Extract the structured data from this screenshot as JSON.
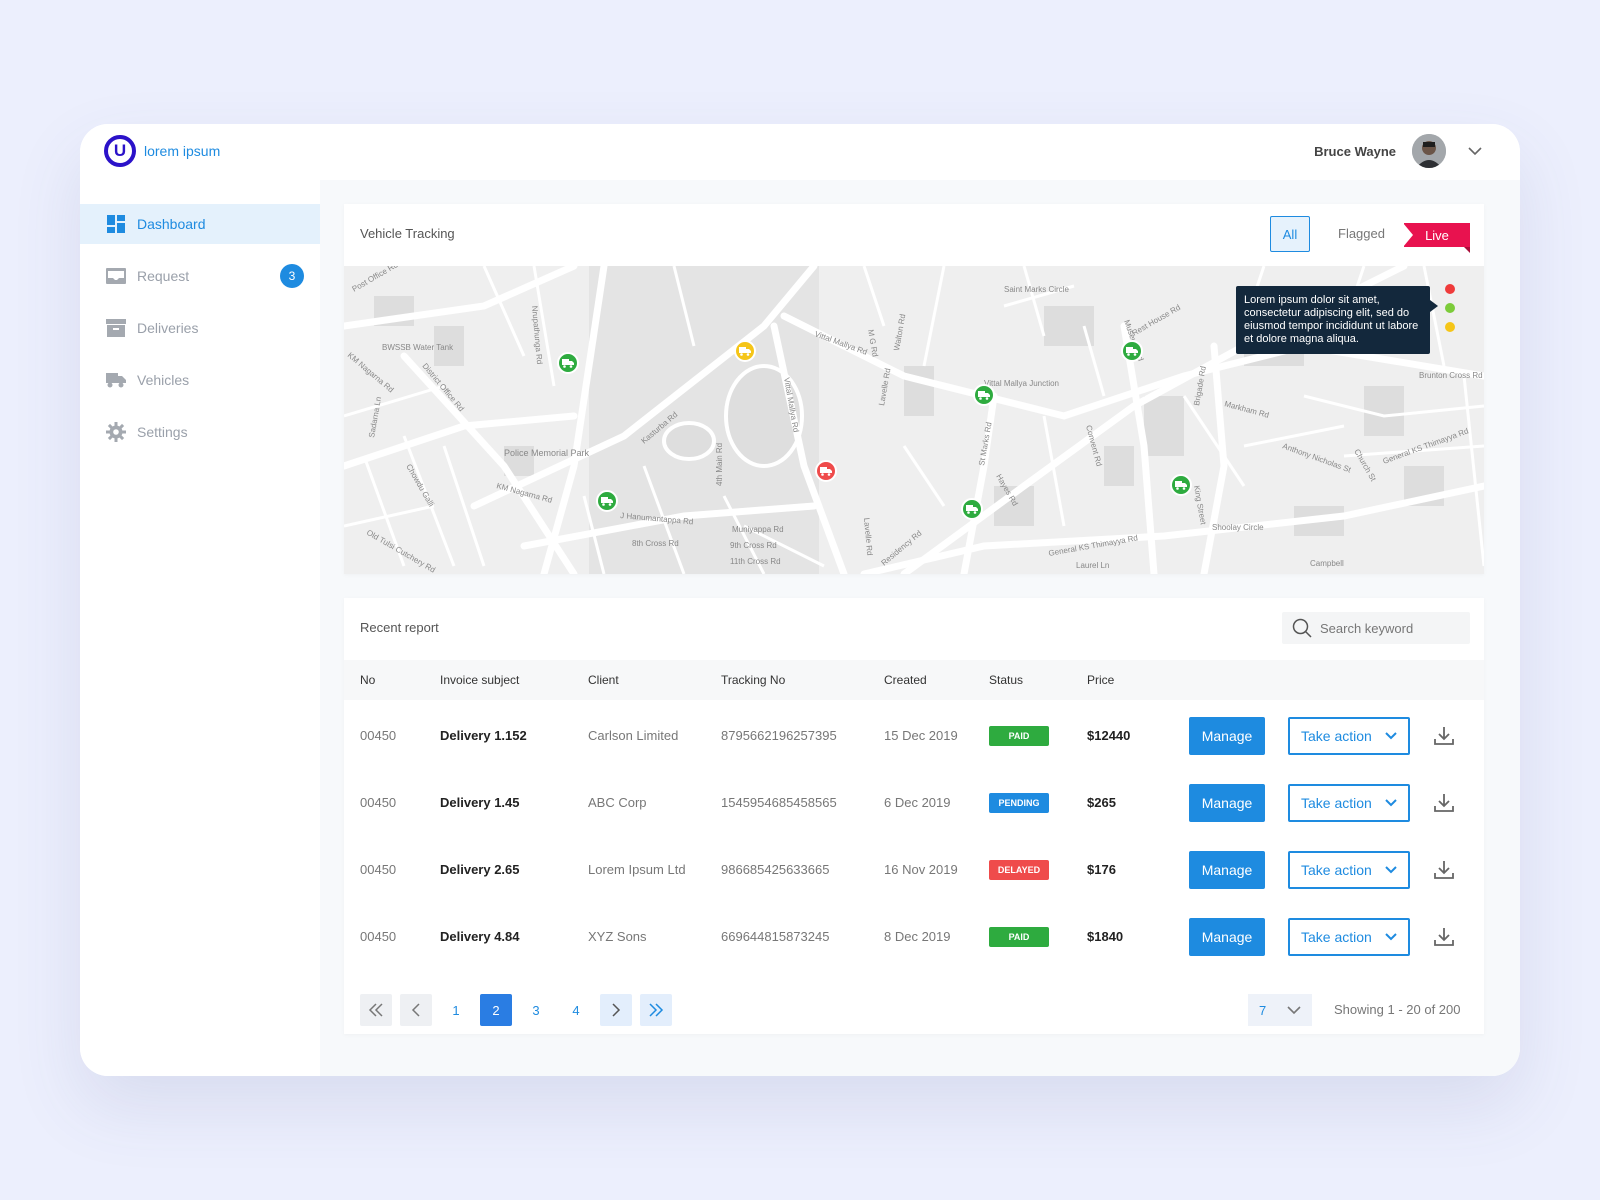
{
  "app": {
    "logo_letter": "U",
    "name": "lorem ipsum"
  },
  "user": {
    "name": "Bruce Wayne",
    "menu_icon": "chevron-down-icon"
  },
  "sidebar": {
    "items": [
      {
        "label": "Dashboard",
        "icon": "dashboard-icon",
        "active": true
      },
      {
        "label": "Request",
        "icon": "inbox-icon",
        "badge": "3"
      },
      {
        "label": "Deliveries",
        "icon": "archive-icon"
      },
      {
        "label": "Vehicles",
        "icon": "truck-icon"
      },
      {
        "label": "Settings",
        "icon": "gear-icon"
      }
    ]
  },
  "tracking": {
    "title": "Vehicle Tracking",
    "tabs": {
      "all": "All",
      "flagged": "Flagged"
    },
    "live_label": "Live",
    "tooltip": "Lorem ipsum dolor sit amet, consectetur adipiscing elit, sed do eiusmod tempor incididunt ut labore et dolore magna aliqua.",
    "status_colors": {
      "green": "#2eab3f",
      "yellow": "#f5c518",
      "red": "#ef4b4b"
    },
    "map_labels": [
      "Post Office Rd",
      "BWSSB Water Tank",
      "KM Nagarna Rd",
      "District Office Rd",
      "Nrupathunga Rd",
      "Police Memorial Park",
      "Kasturba Rd",
      "Vittal Mallya Rd",
      "Vittal Mallya Rd",
      "Vittal Mallya Junction",
      "St Marks Rd",
      "Museum Rd",
      "Saint Marks Circle",
      "Rest House Rd",
      "Residency Rd",
      "Brigade Rd",
      "Markham Rd",
      "Anthony Nicholas St",
      "Brunton Cross Rd",
      "General KS Thimayya Rd",
      "General KS Thimayya Rd",
      "Shoolay Circle",
      "King Street",
      "Church St",
      "Lavelle Rd",
      "Lavelle Rd",
      "M G Rd",
      "Walton Rd",
      "Hayes Rd",
      "Convent Rd",
      "Muniyappa Rd",
      "9th Cross Rd",
      "11th Cross Rd",
      "KM Nagarna Rd",
      "Old Tulsi Cutchery Rd",
      "Chowdu Galli",
      "Sadarna Ln",
      "Campbell",
      "Laurel Ln",
      "J Hanumantappa Rd",
      "4th Main Rd",
      "8th Cross Rd"
    ]
  },
  "report": {
    "title": "Recent report",
    "search_placeholder": "Search keyword",
    "columns": [
      "No",
      "Invoice subject",
      "Client",
      "Tracking No",
      "Created",
      "Status",
      "Price"
    ],
    "rows": [
      {
        "no": "00450",
        "subject": "Delivery 1.152",
        "client": "Carlson Limited",
        "tracking": "8795662196257395",
        "created": "15 Dec 2019",
        "status": "PAID",
        "status_color": "#2eab3f",
        "price": "$12440"
      },
      {
        "no": "00450",
        "subject": "Delivery 1.45",
        "client": "ABC Corp",
        "tracking": "1545954685458565",
        "created": "6 Dec 2019",
        "status": "PENDING",
        "status_color": "#1e8be0",
        "price": "$265"
      },
      {
        "no": "00450",
        "subject": "Delivery 2.65",
        "client": "Lorem Ipsum Ltd",
        "tracking": "986685425633665",
        "created": "16 Nov 2019",
        "status": "DELAYED",
        "status_color": "#ef4b4b",
        "price": "$176"
      },
      {
        "no": "00450",
        "subject": "Delivery 4.84",
        "client": "XYZ Sons",
        "tracking": "669644815873245",
        "created": "8 Dec 2019",
        "status": "PAID",
        "status_color": "#2eab3f",
        "price": "$1840"
      }
    ],
    "manage_label": "Manage",
    "take_action_label": "Take action",
    "pagination": {
      "pages": [
        "1",
        "2",
        "3",
        "4"
      ],
      "current": "2",
      "per_page": "7",
      "showing": "Showing 1 - 20 of 200"
    }
  }
}
